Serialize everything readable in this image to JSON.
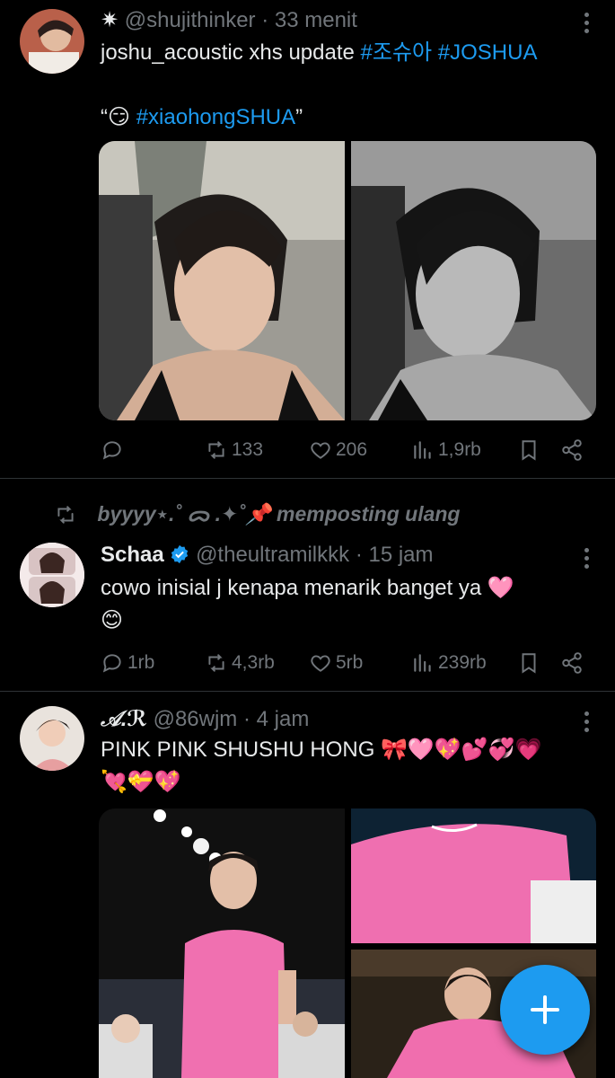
{
  "posts": [
    {
      "author_name": "✷",
      "handle": "@shujithinker",
      "time": "· 33 menit",
      "text_line1_plain": "joshu_acoustic xhs update ",
      "text_line1_tags": "#조슈아 #JOSHUA",
      "text_line2_quote_open": "“",
      "text_line2_emoji": "😏",
      "text_line2_tag": "#xiaohongSHUA",
      "text_line2_quote_close": "”",
      "stats": {
        "reply": "",
        "repost": "133",
        "like": "206",
        "views": "1,9rb"
      }
    },
    {
      "reposted_by": "byyyy⋆.˚ ᯅ .✦˚📌 memposting ulang",
      "author_name": "Schaa",
      "handle": "@theultramilkkk",
      "time": "· 15 jam",
      "text_line1": "cowo inisial j kenapa menarik banget ya 🩷",
      "text_line2": "😊",
      "stats": {
        "reply": "1rb",
        "repost": "4,3rb",
        "like": "5rb",
        "views": "239rb"
      }
    },
    {
      "author_name": "𝒜.ℛ",
      "handle": "@86wjm",
      "time": "· 4 jam",
      "text_line1": "PINK PINK SHUSHU HONG 🎀🩷💖💕💞💗",
      "text_line2": "💘💝💖"
    }
  ],
  "colors": {
    "accent": "#1d9bf0",
    "muted": "#71767b",
    "pink": "#ee5fa6"
  },
  "icons": [
    "reply-icon",
    "repost-icon",
    "like-icon",
    "views-icon",
    "bookmark-icon",
    "share-icon",
    "more-icon",
    "verified-icon",
    "compose-icon"
  ]
}
